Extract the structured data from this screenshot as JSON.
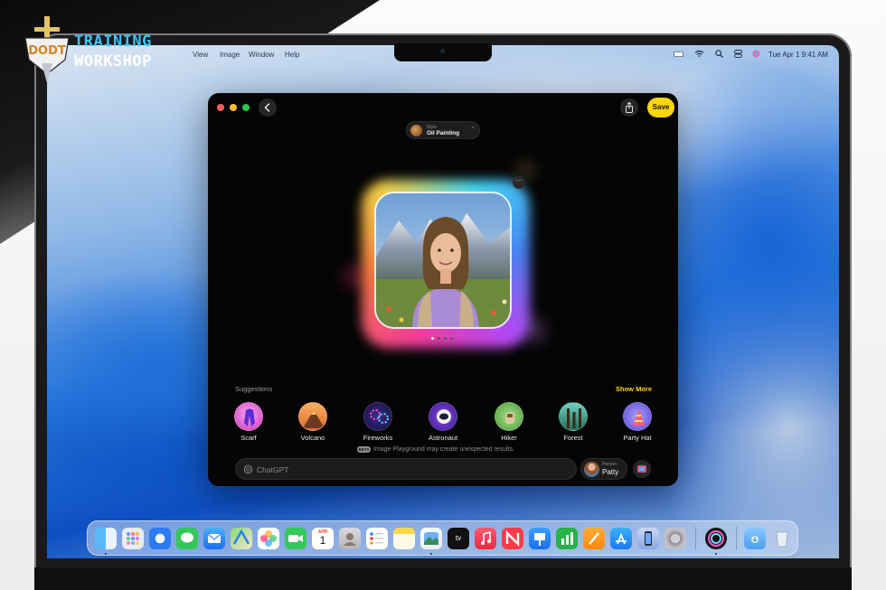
{
  "watermark": {
    "line1": "TRAINING",
    "line2": "WORKSHOP",
    "badge_text": "DODT"
  },
  "menubar": {
    "items": [
      "View",
      "Image",
      "Window",
      "Help"
    ],
    "clock": "Tue Apr 1  9:41 AM"
  },
  "app": {
    "title": "Image Playground",
    "style": {
      "label": "Style",
      "value": "Oil Painting"
    },
    "save_label": "Save",
    "more_label": "···",
    "suggestions_title": "Suggestions",
    "show_more_label": "Show More",
    "suggestions": [
      {
        "label": "Scarf",
        "icon": "scarf-icon",
        "color": "#e14fd0"
      },
      {
        "label": "Volcano",
        "icon": "volcano-icon",
        "color": "#d1742f"
      },
      {
        "label": "Fireworks",
        "icon": "fireworks-icon",
        "color": "#2b1c6a"
      },
      {
        "label": "Astronaut",
        "icon": "astronaut-icon",
        "color": "#6a2fc9"
      },
      {
        "label": "Hiker",
        "icon": "hiker-icon",
        "color": "#6bb85a"
      },
      {
        "label": "Forest",
        "icon": "forest-icon",
        "color": "#2f8a74"
      },
      {
        "label": "Party Hat",
        "icon": "party-hat-icon",
        "color": "#7b6ae8"
      }
    ],
    "beta_badge": "BETA",
    "disclaimer": "Image Playground may create unexpected results.",
    "prompt": {
      "placeholder": "ChatGPT",
      "value": ""
    },
    "person": {
      "label": "Person",
      "name": "Patty"
    },
    "page_dots": {
      "count": 4,
      "active": 0
    }
  },
  "dock": {
    "apps": [
      "Finder",
      "Launchpad",
      "Safari",
      "Messages",
      "Mail",
      "Maps",
      "Photos",
      "FaceTime",
      "Calendar",
      "Contacts",
      "Reminders",
      "Notes",
      "Image Playground",
      "TV",
      "Music",
      "News",
      "Keynote",
      "Numbers",
      "Pages",
      "App Store",
      "iPhone Mirroring",
      "System Settings",
      "Siri",
      "Downloads",
      "Trash"
    ],
    "calendar_day": "1",
    "calendar_month": "APR",
    "tv_label": "tv"
  },
  "colors": {
    "accent": "#ffd60a",
    "window_bg": "#050505",
    "close": "#ff5f57",
    "minimize": "#febc2e",
    "zoom": "#28c840"
  }
}
